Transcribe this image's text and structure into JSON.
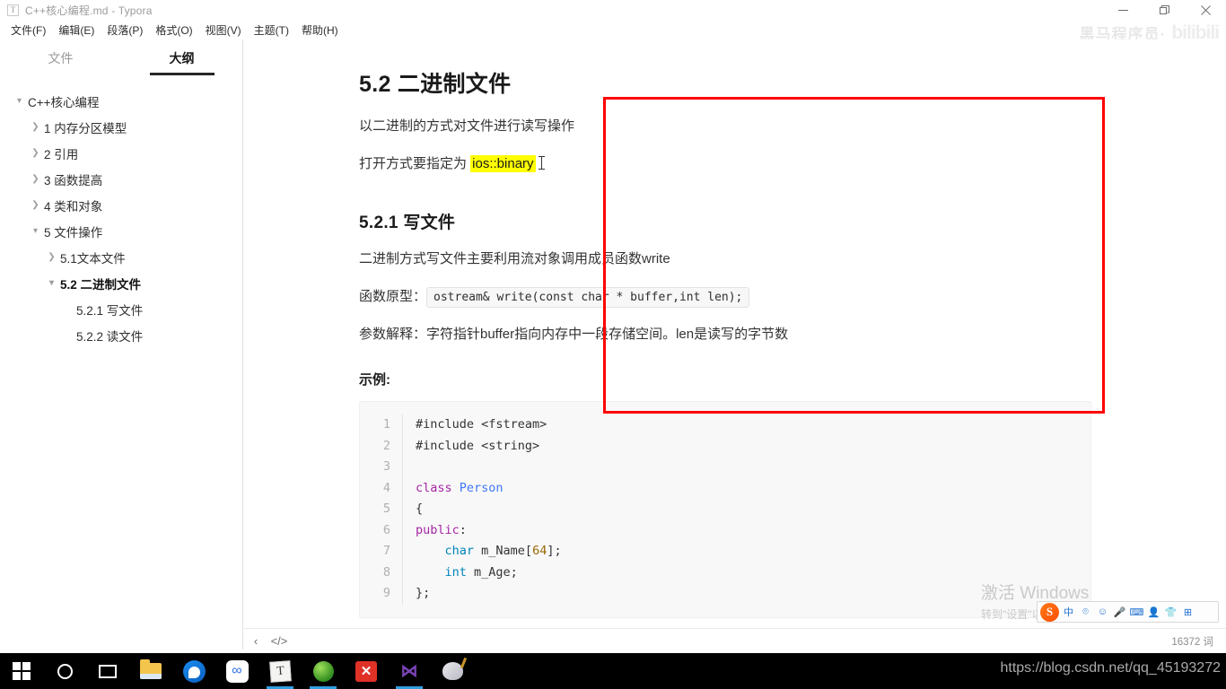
{
  "window": {
    "title": "C++核心编程.md - Typora",
    "app_icon": "T",
    "controls": {
      "minimize": "—",
      "restore": "❐",
      "close": "✕"
    }
  },
  "menubar": {
    "items": [
      {
        "label": "文件(F)",
        "name": "menu-file"
      },
      {
        "label": "编辑(E)",
        "name": "menu-edit"
      },
      {
        "label": "段落(P)",
        "name": "menu-paragraph"
      },
      {
        "label": "格式(O)",
        "name": "menu-format"
      },
      {
        "label": "视图(V)",
        "name": "menu-view"
      },
      {
        "label": "主题(T)",
        "name": "menu-theme"
      },
      {
        "label": "帮助(H)",
        "name": "menu-help"
      }
    ]
  },
  "branding": {
    "cn": "黑马程序员·",
    "site": "bilibili"
  },
  "sidebar": {
    "tabs": [
      {
        "label": "文件",
        "active": false
      },
      {
        "label": "大纲",
        "active": true
      }
    ],
    "outline": [
      {
        "label": "C++核心编程",
        "indent": 0,
        "chevron": "down",
        "selected": false
      },
      {
        "label": "1 内存分区模型",
        "indent": 1,
        "chevron": "right",
        "selected": false
      },
      {
        "label": "2 引用",
        "indent": 1,
        "chevron": "right",
        "selected": false
      },
      {
        "label": "3 函数提高",
        "indent": 1,
        "chevron": "right",
        "selected": false
      },
      {
        "label": "4 类和对象",
        "indent": 1,
        "chevron": "right",
        "selected": false
      },
      {
        "label": "5 文件操作",
        "indent": 1,
        "chevron": "down",
        "selected": false
      },
      {
        "label": "5.1文本文件",
        "indent": 2,
        "chevron": "right",
        "selected": false
      },
      {
        "label": "5.2 二进制文件",
        "indent": 2,
        "chevron": "down",
        "selected": true
      },
      {
        "label": "5.2.1 写文件",
        "indent": 3,
        "chevron": "none",
        "selected": false
      },
      {
        "label": "5.2.2 读文件",
        "indent": 3,
        "chevron": "none",
        "selected": false
      }
    ]
  },
  "document": {
    "heading": "5.2 二进制文件",
    "para1": "以二进制的方式对文件进行读写操作",
    "para2_prefix": "打开方式要指定为 ",
    "para2_highlight": "ios::binary",
    "subheading": "5.2.1 写文件",
    "para3": "二进制方式写文件主要利用流对象调用成员函数write",
    "para4_label": "函数原型：",
    "para4_code": "ostream& write(const char * buffer,int len);",
    "para5": "参数解释：字符指针buffer指向内存中一段存储空间。len是读写的字节数",
    "example_label": "示例:",
    "code_lines": [
      {
        "n": "1",
        "segments": [
          {
            "t": "#include <fstream>",
            "c": ""
          }
        ]
      },
      {
        "n": "2",
        "segments": [
          {
            "t": "#include <string>",
            "c": ""
          }
        ]
      },
      {
        "n": "3",
        "segments": [
          {
            "t": "",
            "c": ""
          }
        ]
      },
      {
        "n": "4",
        "segments": [
          {
            "t": "class ",
            "c": "k"
          },
          {
            "t": "Person",
            "c": "cn"
          }
        ]
      },
      {
        "n": "5",
        "segments": [
          {
            "t": "{",
            "c": ""
          }
        ]
      },
      {
        "n": "6",
        "segments": [
          {
            "t": "public",
            "c": "k"
          },
          {
            "t": ":",
            "c": ""
          }
        ]
      },
      {
        "n": "7",
        "segments": [
          {
            "t": "    ",
            "c": ""
          },
          {
            "t": "char",
            "c": "t"
          },
          {
            "t": " m_Name[",
            "c": ""
          },
          {
            "t": "64",
            "c": "n"
          },
          {
            "t": "];",
            "c": ""
          }
        ]
      },
      {
        "n": "8",
        "segments": [
          {
            "t": "    ",
            "c": ""
          },
          {
            "t": "int",
            "c": "t"
          },
          {
            "t": " m_Age;",
            "c": ""
          }
        ]
      },
      {
        "n": "9",
        "segments": [
          {
            "t": "};",
            "c": ""
          }
        ]
      }
    ]
  },
  "statusbar": {
    "back_icon": "‹",
    "source_icon": "</>",
    "word_count": "16372 词"
  },
  "activation": {
    "line1": "激活 Windows",
    "line2": "转到\"设置\"以激活 Windows。"
  },
  "ime": {
    "logo": "S",
    "mode": "中",
    "items": [
      "中",
      "⌾",
      "☺",
      "🎤",
      "⌨",
      "👤",
      "👕",
      "⊞"
    ]
  },
  "taskbar": {
    "items": [
      {
        "name": "start-button",
        "icon": "windows",
        "running": false
      },
      {
        "name": "cortana-button",
        "icon": "circle",
        "running": false
      },
      {
        "name": "task-view-button",
        "icon": "taskview",
        "running": false
      },
      {
        "name": "file-explorer",
        "icon": "folder",
        "running": false
      },
      {
        "name": "browser-app",
        "icon": "qq",
        "running": false
      },
      {
        "name": "baidu-netdisk",
        "icon": "baidu",
        "running": false
      },
      {
        "name": "typora-app",
        "icon": "typora",
        "running": true
      },
      {
        "name": "green-app",
        "icon": "green",
        "running": true
      },
      {
        "name": "xmind-app",
        "icon": "xmind",
        "running": false
      },
      {
        "name": "visual-studio",
        "icon": "vs",
        "running": true
      },
      {
        "name": "paint-app",
        "icon": "paint",
        "running": false
      }
    ]
  },
  "url_watermark": "https://blog.csdn.net/qq_45193272",
  "colors": {
    "accent_red": "#ff0000",
    "highlight": "#ffff00",
    "taskbar": "#000000",
    "running_indicator": "#2f9fe0"
  }
}
